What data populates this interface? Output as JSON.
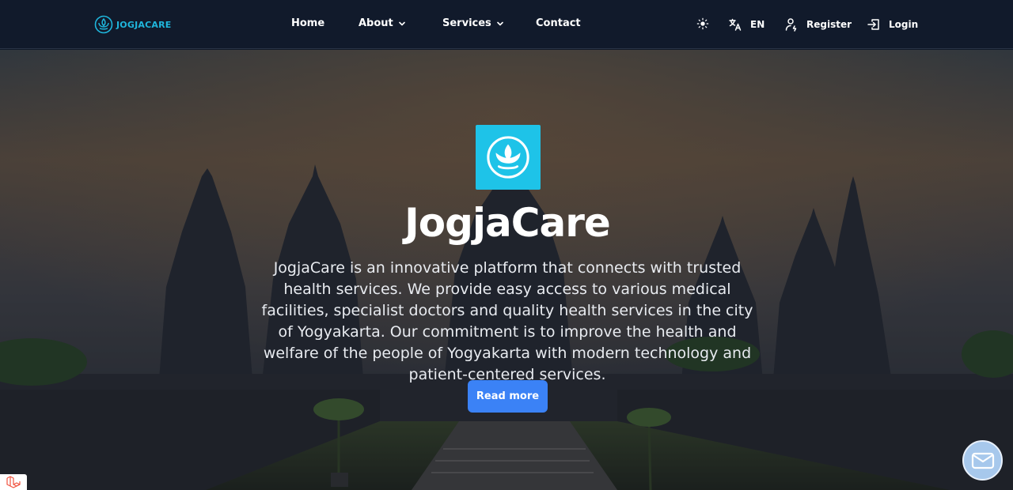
{
  "navbar": {
    "brand": "JOGJACARE",
    "menu": [
      {
        "label": "Home"
      },
      {
        "label": "About"
      },
      {
        "label": "Services"
      },
      {
        "label": "Contact"
      }
    ],
    "language": "EN",
    "register": "Register",
    "login": "Login"
  },
  "hero": {
    "title": "JogjaCare",
    "description": "JogjaCare is an innovative platform that connects with trusted health services. We provide easy access to various medical facilities, specialist doctors and quality health services in the city of Yogyakarta. Our commitment is to improve the health and welfare of the people of Yogyakarta with modern technology and patient-centered services.",
    "cta": "Read more"
  },
  "icons": {
    "theme": "sun-icon",
    "language": "translate-icon",
    "register": "user-plus-icon",
    "login": "login-icon",
    "chat": "mail-icon"
  },
  "colors": {
    "navbar": "#111a2b",
    "brand": "#1fb6dc",
    "logo_bg": "#1ec3e8",
    "cta": "#3b82f6",
    "chat": "#a7c8ec"
  }
}
